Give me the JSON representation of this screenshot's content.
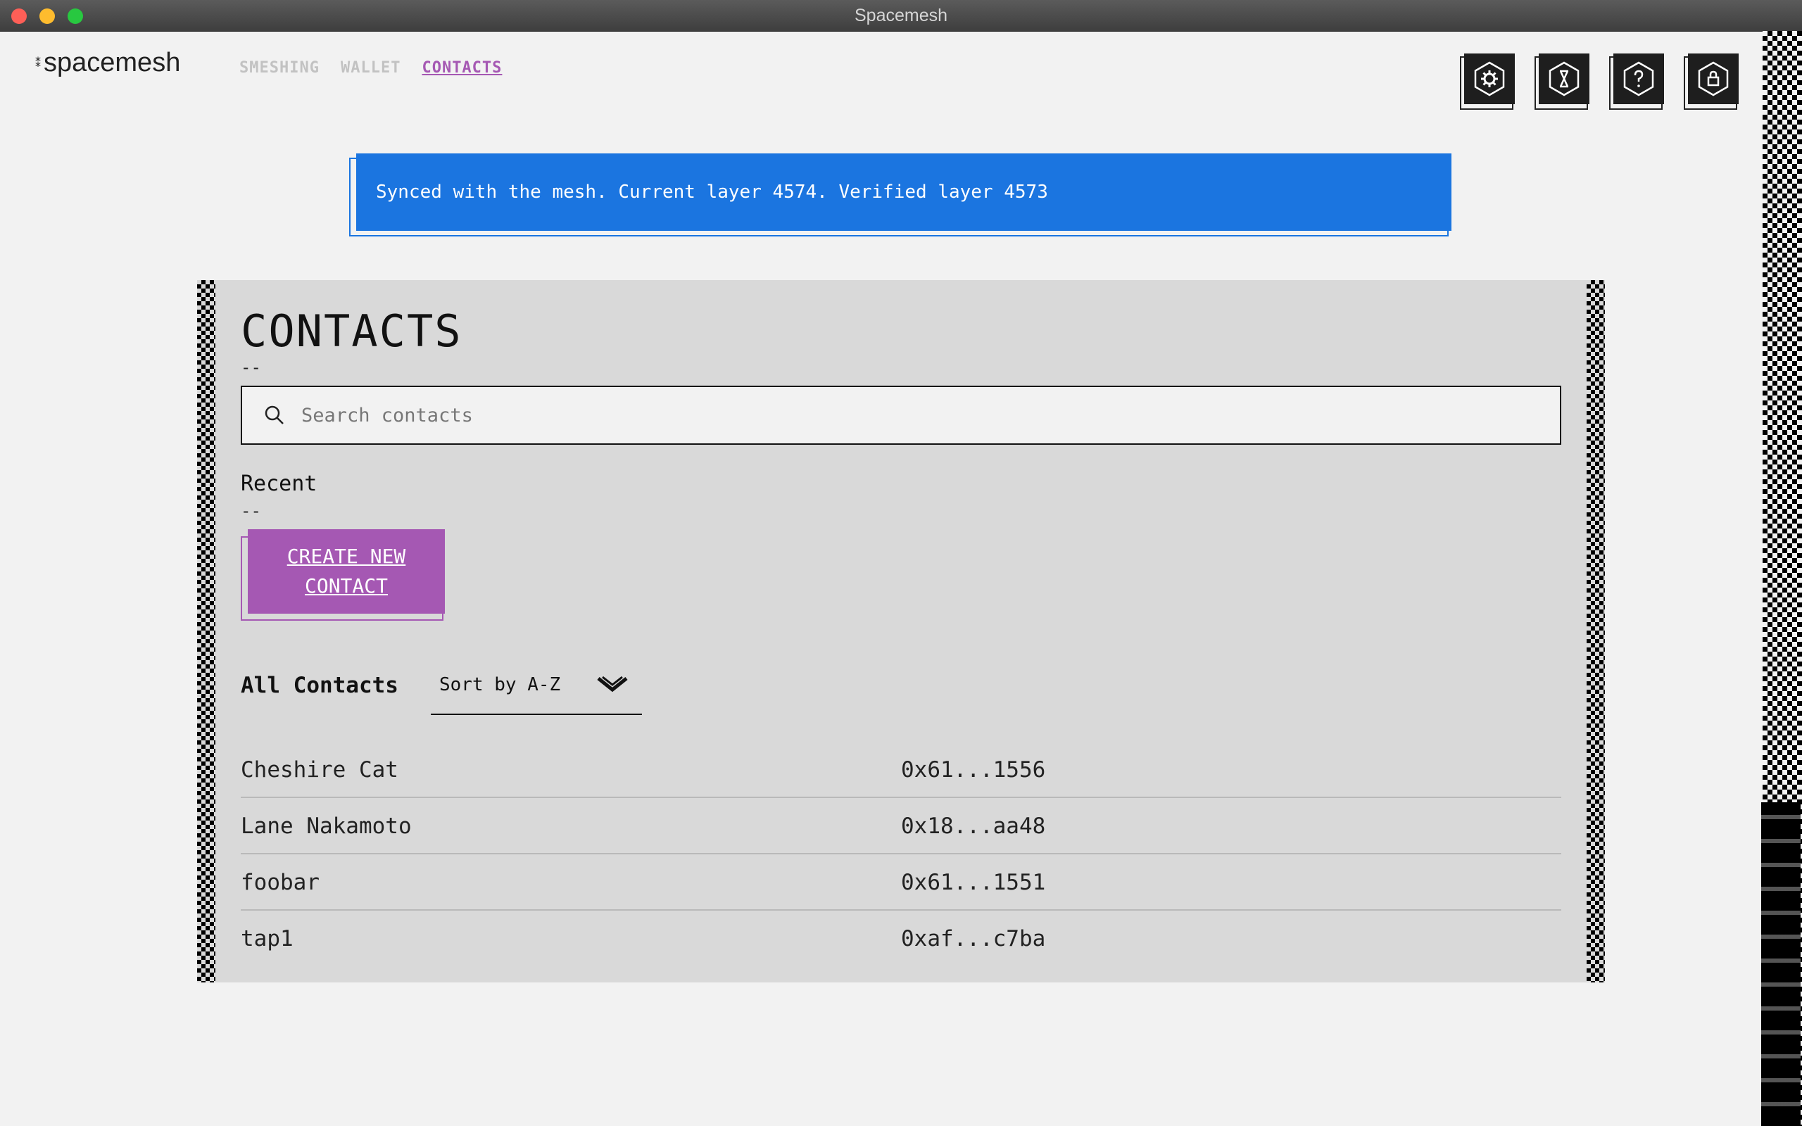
{
  "window": {
    "title": "Spacemesh"
  },
  "header": {
    "logo": "spacemesh",
    "logo_mark": "⁑",
    "nav": [
      {
        "label": "SMESHING",
        "active": false
      },
      {
        "label": "WALLET",
        "active": false
      },
      {
        "label": "CONTACTS",
        "active": true
      }
    ],
    "icons": [
      "settings-icon",
      "hourglass-icon",
      "help-icon",
      "lock-icon"
    ]
  },
  "banner": {
    "text": "Synced with the mesh. Current layer 4574. Verified layer 4573"
  },
  "contacts_page": {
    "title": "CONTACTS",
    "title_dash": "--",
    "search_placeholder": "Search contacts",
    "recent_label": "Recent",
    "recent_dash": "--",
    "create_button": "CREATE NEW CONTACT",
    "all_label": "All Contacts",
    "sort_label": "Sort by A-Z",
    "contacts": [
      {
        "name": "Cheshire Cat",
        "address": "0x61...1556"
      },
      {
        "name": "Lane Nakamoto",
        "address": "0x18...aa48"
      },
      {
        "name": "foobar",
        "address": "0x61...1551"
      },
      {
        "name": "tap1",
        "address": "0xaf...c7ba"
      }
    ]
  },
  "colors": {
    "accent": "#a558b3",
    "banner": "#1b75e0",
    "panel": "#d9d9d9",
    "background": "#f2f2f2"
  }
}
